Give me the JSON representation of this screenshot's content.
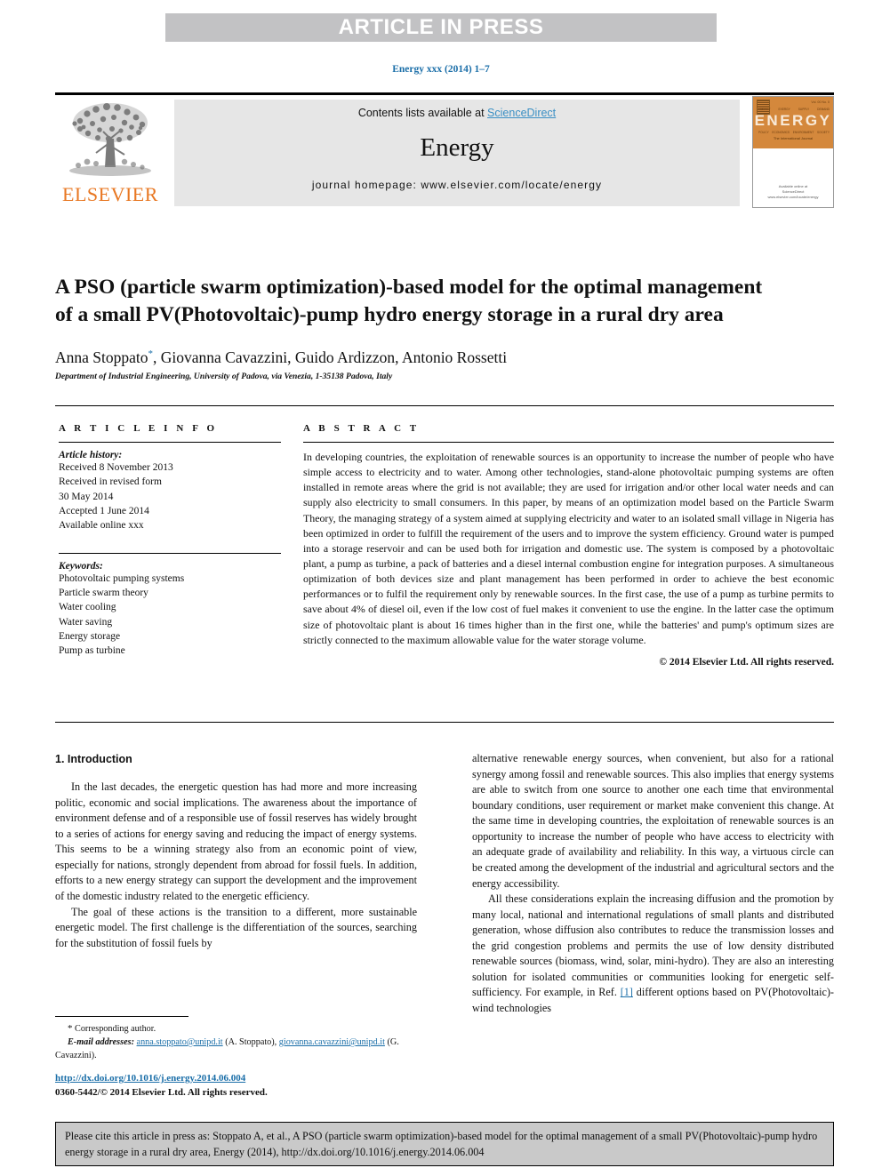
{
  "banner": {
    "text": "ARTICLE IN PRESS"
  },
  "running_head": "Energy xxx (2014) 1–7",
  "masthead": {
    "contents_prefix": "Contents lists available at ",
    "sciencedirect": "ScienceDirect",
    "journal_name": "Energy",
    "homepage": "journal homepage: www.elsevier.com/locate/energy",
    "publisher_name": "ELSEVIER",
    "cover": {
      "title": "ENERGY",
      "issue_label": "Vol. 00 No. 0",
      "subtitle": "The International Journal",
      "bottom_line1": "Available online at",
      "bottom_line2": "ScienceDirect",
      "bottom_line3": "www.elsevier.com/locate/energy",
      "mini_labels": [
        "ENERGY",
        "EXERGY",
        "SUPPLY",
        "DEMAND"
      ],
      "mini_labels2": [
        "POLICY",
        "ECONOMICS",
        "ENVIRONMENT",
        "SOCIETY"
      ]
    }
  },
  "article": {
    "title": "A PSO (particle swarm optimization)-based model for the optimal management of a small PV(Photovoltaic)-pump hydro energy storage in a rural dry area",
    "authors": "Anna Stoppato",
    "corresponding_mark": "*",
    "authors_rest": ", Giovanna Cavazzini, Guido Ardizzon, Antonio Rossetti",
    "affiliation": "Department of Industrial Engineering, University of Padova, via Venezia, 1-35138 Padova, Italy"
  },
  "info": {
    "label": "A R T I C L E   I N F O",
    "history_heading": "Article history:",
    "history": [
      "Received 8 November 2013",
      "Received in revised form",
      "30 May 2014",
      "Accepted 1 June 2014",
      "Available online xxx"
    ],
    "keywords_heading": "Keywords:",
    "keywords": [
      "Photovoltaic pumping systems",
      "Particle swarm theory",
      "Water cooling",
      "Water saving",
      "Energy storage",
      "Pump as turbine"
    ]
  },
  "abstract": {
    "label": "A B S T R A C T",
    "text": "In developing countries, the exploitation of renewable sources is an opportunity to increase the number of people who have simple access to electricity and to water. Among other technologies, stand-alone photovoltaic pumping systems are often installed in remote areas where the grid is not available; they are used for irrigation and/or other local water needs and can supply also electricity to small consumers. In this paper, by means of an optimization model based on the Particle Swarm Theory, the managing strategy of a system aimed at supplying electricity and water to an isolated small village in Nigeria has been optimized in order to fulfill the requirement of the users and to improve the system efficiency. Ground water is pumped into a storage reservoir and can be used both for irrigation and domestic use. The system is composed by a photovoltaic plant, a pump as turbine, a pack of batteries and a diesel internal combustion engine for integration purposes. A simultaneous optimization of both devices size and plant management has been performed in order to achieve the best economic performances or to fulfil the requirement only by renewable sources. In the first case, the use of a pump as turbine permits to save about 4% of diesel oil, even if the low cost of fuel makes it convenient to use the engine. In the latter case the optimum size of photovoltaic plant is about 16 times higher than in the first one, while the batteries' and pump's optimum sizes are strictly connected to the maximum allowable value for the water storage volume.",
    "copyright": "© 2014 Elsevier Ltd. All rights reserved."
  },
  "introduction": {
    "heading": "1. Introduction",
    "left_p1": "In the last decades, the energetic question has had more and more increasing politic, economic and social implications. The awareness about the importance of environment defense and of a responsible use of fossil reserves has widely brought to a series of actions for energy saving and reducing the impact of energy systems. This seems to be a winning strategy also from an economic point of view, especially for nations, strongly dependent from abroad for fossil fuels. In addition, efforts to a new energy strategy can support the development and the improvement of the domestic industry related to the energetic efficiency.",
    "left_p2": "The goal of these actions is the transition to a different, more sustainable energetic model. The first challenge is the differentiation of the sources, searching for the substitution of fossil fuels by",
    "right_p1": "alternative renewable energy sources, when convenient, but also for a rational synergy among fossil and renewable sources. This also implies that energy systems are able to switch from one source to another one each time that environmental boundary conditions, user requirement or market make convenient this change. At the same time in developing countries, the exploitation of renewable sources is an opportunity to increase the number of people who have access to electricity with an adequate grade of availability and reliability. In this way, a virtuous circle can be created among the development of the industrial and agricultural sectors and the energy accessibility.",
    "right_p2_before": "All these considerations explain the increasing diffusion and the promotion by many local, national and international regulations of small plants and distributed generation, whose diffusion also contributes to reduce the transmission losses and the grid congestion problems and permits the use of low density distributed renewable sources (biomass, wind, solar, mini-hydro). They are also an interesting solution for isolated communities or communities looking for energetic self-sufficiency. For example, in Ref. ",
    "right_p2_ref": "[1]",
    "right_p2_after": " different options based on PV(Photovoltaic)-wind technologies"
  },
  "footnote": {
    "corresponding": "Corresponding author.",
    "email_label": "E-mail addresses:",
    "email1": "anna.stoppato@unipd.it",
    "email1_owner": " (A. Stoppato), ",
    "email2": "giovanna.cavazzini@unipd.it",
    "email2_owner": " (G. Cavazzini).",
    "doi": "http://dx.doi.org/10.1016/j.energy.2014.06.004",
    "issn": "0360-5442/© 2014 Elsevier Ltd. All rights reserved."
  },
  "citation_box": {
    "text": "Please cite this article in press as: Stoppato A, et al., A PSO (particle swarm optimization)-based model for the optimal management of a small PV(Photovoltaic)-pump hydro energy storage in a rural dry area, Energy (2014), http://dx.doi.org/10.1016/j.energy.2014.06.004"
  },
  "colors": {
    "banner_gray": "#c2c2c4",
    "link_blue": "#1a6ea8",
    "sciencedirect_blue": "#3a8fc4",
    "elsevier_orange": "#e87722",
    "box_gray": "#e6e6e6",
    "cite_gray": "#c9c9c9"
  }
}
